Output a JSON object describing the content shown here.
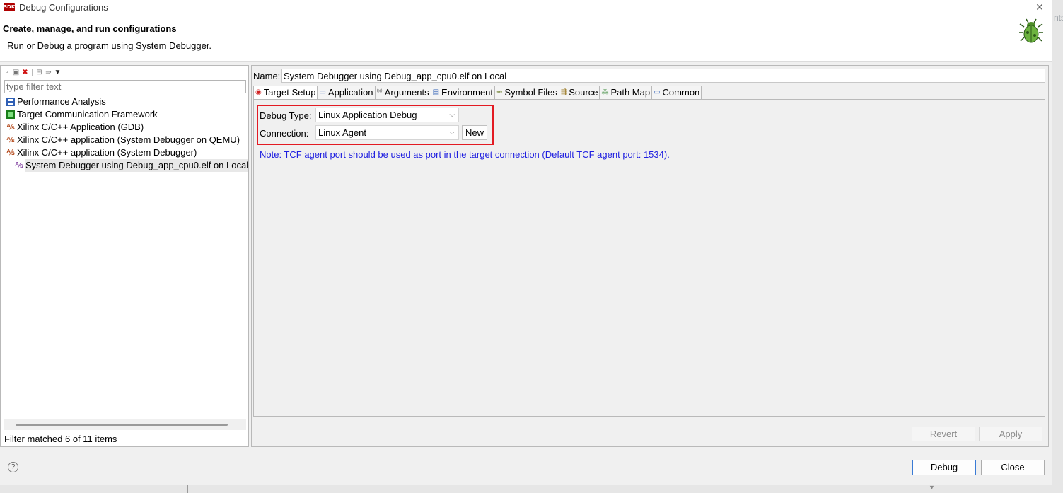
{
  "window": {
    "app_icon_text": "SDK",
    "title": "Debug Configurations",
    "close_glyph": "✕"
  },
  "header": {
    "title": "Create, manage, and run configurations",
    "subtitle": "Run or Debug a program using System Debugger.",
    "icon": "bug-icon",
    "outside_fragment": "nts"
  },
  "left": {
    "toolbar_icons": [
      "new-config-icon",
      "duplicate-icon",
      "delete-icon",
      "collapse-all-icon",
      "filter-icon",
      "dropdown-icon"
    ],
    "filter_placeholder": "type filter text",
    "tree": [
      {
        "label": "Performance Analysis",
        "icon": "performance-icon"
      },
      {
        "label": "Target Communication Framework",
        "icon": "tcf-icon"
      },
      {
        "label": "Xilinx C/C++ Application (GDB)",
        "icon": "xilinx-icon"
      },
      {
        "label": "Xilinx C/C++ application (System Debugger on QEMU)",
        "icon": "xilinx-icon"
      },
      {
        "label": "Xilinx C/C++ application (System Debugger)",
        "icon": "xilinx-icon"
      },
      {
        "label": "System Debugger using Debug_app_cpu0.elf on Local",
        "icon": "xilinx-config-icon",
        "selected": true
      }
    ],
    "status": "Filter matched 6 of 11 items"
  },
  "right": {
    "name_label": "Name:",
    "name_value": "System Debugger using Debug_app_cpu0.elf on Local",
    "tabs": [
      {
        "label": "Target Setup",
        "icon": "target-icon",
        "active": true
      },
      {
        "label": "Application",
        "icon": "application-icon"
      },
      {
        "label": "Arguments",
        "icon": "arguments-icon"
      },
      {
        "label": "Environment",
        "icon": "environment-icon"
      },
      {
        "label": "Symbol Files",
        "icon": "symbol-files-icon"
      },
      {
        "label": "Source",
        "icon": "source-icon"
      },
      {
        "label": "Path Map",
        "icon": "path-map-icon"
      },
      {
        "label": "Common",
        "icon": "common-icon"
      }
    ],
    "debug_type_label": "Debug Type:",
    "debug_type_value": "Linux Application Debug",
    "connection_label": "Connection:",
    "connection_value": "Linux Agent",
    "new_label": "New",
    "note": "Note: TCF agent port should be used as port in the target connection (Default TCF agent port: 1534).",
    "revert_label": "Revert",
    "apply_label": "Apply"
  },
  "footer": {
    "help_glyph": "?",
    "debug_label": "Debug",
    "close_label": "Close"
  },
  "colors": {
    "highlight": "#e31b23",
    "note_text": "#1e1ee0",
    "dialog_bg": "#f0f0f0"
  }
}
